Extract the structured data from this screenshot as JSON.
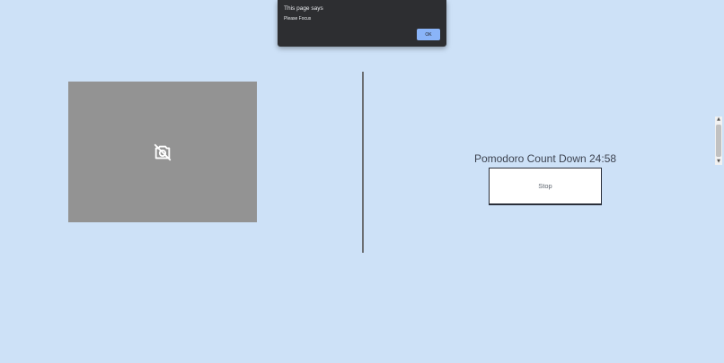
{
  "alert": {
    "title": "This page says",
    "message": "Please Focus",
    "ok_label": "OK"
  },
  "camera": {
    "icon": "camera-off-icon"
  },
  "timer": {
    "label": "Pomodoro Count Down 24:58",
    "stop_label": "Stop"
  },
  "scrollbar": {
    "up_arrow": "▲",
    "down_arrow": "▼"
  },
  "colors": {
    "background": "#cde1f7",
    "camera_placeholder": "#939393",
    "dialog_background": "#2d2e31",
    "dialog_button": "#8ab4f8"
  }
}
